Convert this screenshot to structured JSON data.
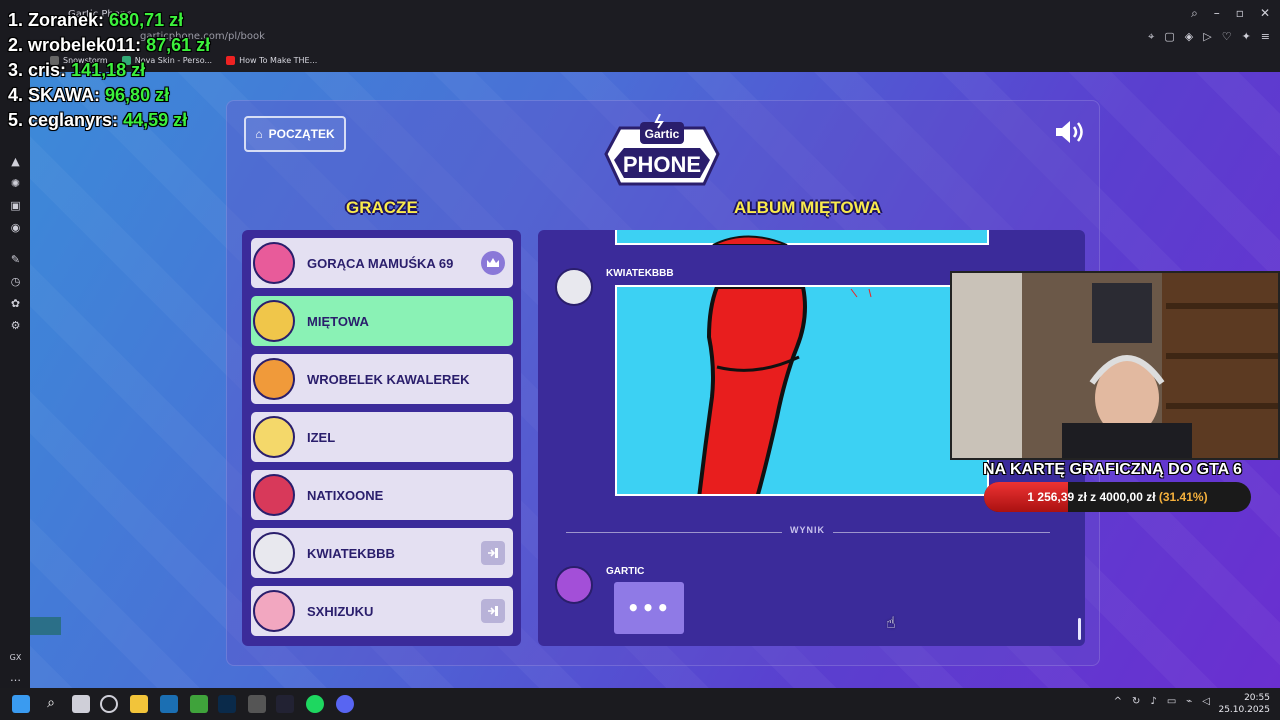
{
  "leaderboard": [
    {
      "rank_name": "1. Zoranek:",
      "amount": "680,71 zł"
    },
    {
      "rank_name": "2. wrobelek011:",
      "amount": "87,61 zł"
    },
    {
      "rank_name": "3. cris:",
      "amount": "141,18 zł"
    },
    {
      "rank_name": "4. SKAWA:",
      "amount": "96,80 zł"
    },
    {
      "rank_name": "5. ceglanyrs:",
      "amount": "44,59 zł"
    }
  ],
  "browser": {
    "tab_title": "Gartic Phone",
    "url": "garticphone.com/pl/book",
    "bookmarks": [
      "Snowstorm",
      "Nova Skin - Perso...",
      "How To Make THE..."
    ]
  },
  "game": {
    "home_label": "POCZĄTEK",
    "logo_line1": "Gartic",
    "logo_line2": "PHONE",
    "players_title": "GRACZE",
    "album_title": "ALBUM MIĘTOWA",
    "players": [
      {
        "name": "GORĄCA MAMUŚKA 69",
        "icon": "crown-icon",
        "active": false
      },
      {
        "name": "MIĘTOWA",
        "icon": "",
        "active": true
      },
      {
        "name": "WROBELEK KAWALEREK",
        "icon": "",
        "active": false
      },
      {
        "name": "IZEL",
        "icon": "",
        "active": false
      },
      {
        "name": "NATIXOONE",
        "icon": "",
        "active": false
      },
      {
        "name": "KWIATEKBBB",
        "icon": "exit-icon",
        "active": false
      },
      {
        "name": "SXHIZUKU",
        "icon": "exit-icon",
        "active": false
      }
    ],
    "album": {
      "drawer_name": "KWIATEKBBB",
      "result_label": "WYNIK",
      "result_author": "GARTIC",
      "typing_indicator": "•••"
    }
  },
  "overlay": {
    "goal_title": "NA KARTĘ GRAFICZNĄ DO GTA 6",
    "goal_raised": "1 256,39 zł",
    "goal_target": "4000,00 zł",
    "goal_percent_label": "(31.41%)",
    "goal_fraction": 0.3141
  },
  "taskbar": {
    "time": "20:55",
    "date": "25.10.2025"
  },
  "colors": {
    "accent_title": "#f9ea4c",
    "active_player": "#8af2b5",
    "panel": "#3b2b9a",
    "money_green": "#3cf03c"
  }
}
